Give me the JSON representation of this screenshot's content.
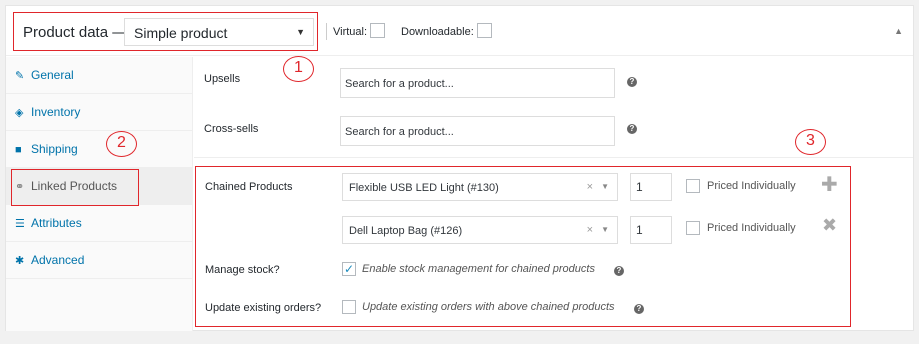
{
  "header": {
    "product_data_label": "Product data —",
    "product_type": {
      "selected": "Simple product"
    },
    "virtual_label": "Virtual:",
    "downloadable_label": "Downloadable:"
  },
  "tabs": [
    {
      "label": "General",
      "icon": "wrench-icon"
    },
    {
      "label": "Inventory",
      "icon": "tag-icon"
    },
    {
      "label": "Shipping",
      "icon": "truck-icon"
    },
    {
      "label": "Linked Products",
      "icon": "link-icon",
      "active": true
    },
    {
      "label": "Attributes",
      "icon": "list-icon"
    },
    {
      "label": "Advanced",
      "icon": "gear-icon"
    }
  ],
  "upsells": {
    "label": "Upsells",
    "placeholder": "Search for a product..."
  },
  "crosssells": {
    "label": "Cross-sells",
    "placeholder": "Search for a product..."
  },
  "chained": {
    "label": "Chained Products",
    "items": [
      {
        "product": "Flexible USB LED Light (#130)",
        "quantity": "1",
        "priced_label": "Priced Individually"
      },
      {
        "product": "Dell Laptop Bag (#126)",
        "quantity": "1",
        "priced_label": "Priced Individually"
      }
    ]
  },
  "manage_stock": {
    "label": "Manage stock?",
    "description": "Enable stock management for chained products",
    "checked": true
  },
  "update_orders": {
    "label": "Update existing orders?",
    "description": "Update existing orders with above chained products",
    "checked": false
  },
  "annotations": [
    "1",
    "2",
    "3"
  ],
  "colors": {
    "link": "#0073aa",
    "annotation": "#e0262b",
    "checkbox": "#1e8cbe"
  }
}
